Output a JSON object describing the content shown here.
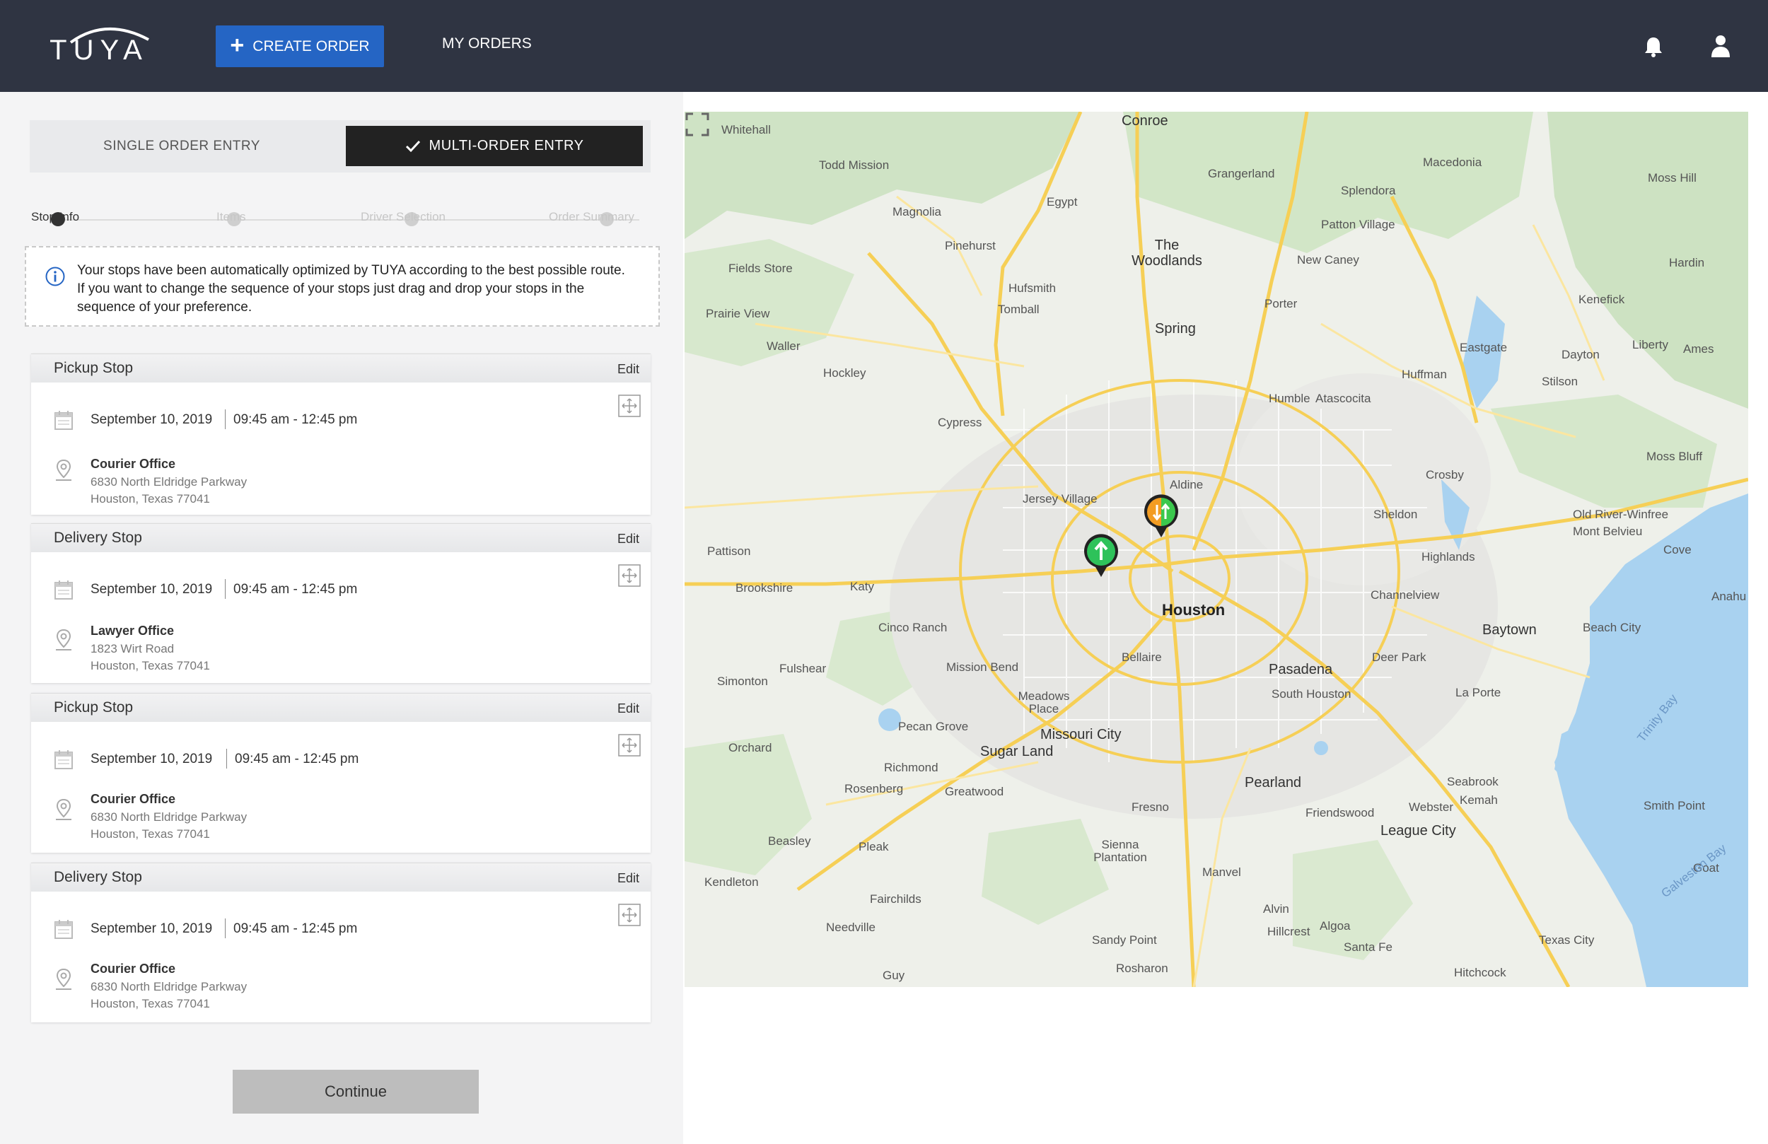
{
  "header": {
    "logo_text": "TUYA",
    "create_order_label": "CREATE ORDER",
    "my_orders_label": "MY ORDERS",
    "icons": [
      "bell-icon",
      "user-icon"
    ]
  },
  "entry_toggle": {
    "single_label": "SINGLE ORDER ENTRY",
    "multi_label": "MULTI-ORDER ENTRY",
    "selected": "multi"
  },
  "stepper": {
    "steps": [
      "Stop Info",
      "Items",
      "Driver Selection",
      "Order Summary"
    ],
    "active_index": 0
  },
  "info": {
    "text": "Your stops have been automatically optimized by TUYA according to the best possible route. If you want to change the sequence of your stops just drag and drop your stops in the sequence of your preference."
  },
  "stops": [
    {
      "type": "Pickup Stop",
      "edit": "Edit",
      "date": "September 10, 2019",
      "time": "09:45 am - 12:45 pm",
      "name": "Courier Office",
      "addr1": "6830 North Eldridge Parkway",
      "addr2": "Houston, Texas 77041"
    },
    {
      "type": "Delivery Stop",
      "edit": "Edit",
      "date": "September 10, 2019",
      "time": "09:45 am - 12:45 pm",
      "name": "Lawyer Office",
      "addr1": "1823 Wirt Road",
      "addr2": "Houston, Texas 77041"
    },
    {
      "type": "Pickup Stop",
      "edit": "Edit",
      "date": "September 10, 2019",
      "time": "09:45 am - 12:45 pm",
      "name": "Courier Office",
      "addr1": "6830 North Eldridge Parkway",
      "addr2": "Houston, Texas 77041"
    },
    {
      "type": "Delivery Stop",
      "edit": "Edit",
      "date": "September 10, 2019",
      "time": "09:45 am - 12:45 pm",
      "name": "Courier Office",
      "addr1": "6830 North Eldridge Parkway",
      "addr2": "Houston, Texas 77041"
    }
  ],
  "continue_label": "Continue",
  "map": {
    "labels": {
      "houston": "Houston",
      "conroe": "Conroe",
      "the_woodlands": "The Woodlands",
      "spring": "Spring",
      "pasadena": "Pasadena",
      "pearland": "Pearland",
      "sugar_land": "Sugar Land",
      "missouri_city": "Missouri City",
      "league_city": "League City",
      "baytown": "Baytown",
      "texas_city": "Texas City",
      "humble": "Humble",
      "cypress": "Cypress",
      "katy": "Katy",
      "tomball": "Tomball",
      "magnolia": "Magnolia",
      "whitehall": "Whitehall",
      "todd_mission": "Todd Mission",
      "grangerland": "Grangerland",
      "macedonia": "Macedonia",
      "moss_hill": "Moss Hill",
      "splendora": "Splendora",
      "patton_village": "Patton Village",
      "new_caney": "New Caney",
      "porter": "Porter",
      "egypt": "Egypt",
      "pinehurst": "Pinehurst",
      "hufsmith": "Hufsmith",
      "fields_store": "Fields Store",
      "prairie_view": "Prairie View",
      "waller": "Waller",
      "hockley": "Hockley",
      "aldine": "Aldine",
      "jersey_village": "Jersey Village",
      "sheldon": "Sheldon",
      "crosby": "Crosby",
      "highlands": "Highlands",
      "channelview": "Channelview",
      "bellaire": "Bellaire",
      "mission_bend": "Mission Bend",
      "cinco_ranch": "Cinco Ranch",
      "brookshire": "Brookshire",
      "pattison": "Pattison",
      "fulshear": "Fulshear",
      "simonton": "Simonton",
      "richmond": "Richmond",
      "rosenberg": "Rosenberg",
      "greatwood": "Greatwood",
      "pecan_grove": "Pecan Grove",
      "meadows_place": "Meadows Place",
      "fresno": "Fresno",
      "sienna_plantation": "Sienna Plantation",
      "manvel": "Manvel",
      "alvin": "Alvin",
      "hillcrest": "Hillcrest",
      "algoa": "Algoa",
      "santa_fe": "Santa Fe",
      "hitchcock": "Hitchcock",
      "friendswood": "Friendswood",
      "webster": "Webster",
      "seabrook": "Seabrook",
      "kemah": "Kemah",
      "la_porte": "La Porte",
      "deer_park": "Deer Park",
      "south_houston": "South Houston",
      "beach_city": "Beach City",
      "smith_point": "Smith Point",
      "goat": "Goat",
      "dayton": "Dayton",
      "liberty": "Liberty",
      "ames": "Ames",
      "kenefick": "Kenefick",
      "hardin": "Hardin",
      "stilson": "Stilson",
      "eastgate": "Eastgate",
      "huffman": "Huffman",
      "atascocita": "Atascocita",
      "moss_bluff": "Moss Bluff",
      "old_river_winfree": "Old River-Winfree",
      "mont_belvieu": "Mont Belvieu",
      "cove": "Cove",
      "anahuac": "Anahu",
      "orchard": "Orchard",
      "beasley": "Beasley",
      "kendleton": "Kendleton",
      "pleak": "Pleak",
      "fairchilds": "Fairchilds",
      "needville": "Needville",
      "guy": "Guy",
      "sandy_point": "Sandy Point",
      "rosharon": "Rosharon",
      "trinity_bay": "Trinity Bay",
      "galveston_bay": "Galveston Bay"
    },
    "icons": [
      "fullscreen-icon",
      "pickup-marker",
      "delivery-marker"
    ]
  }
}
